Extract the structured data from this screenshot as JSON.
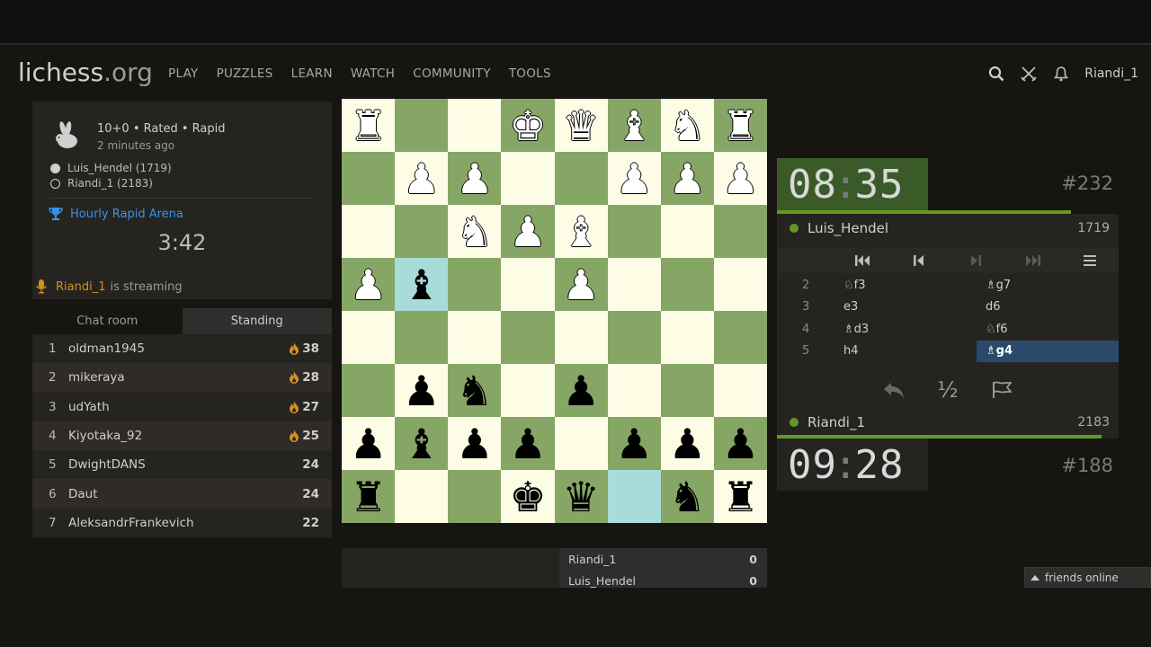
{
  "header": {
    "logo_main": "lichess",
    "logo_tld": ".org",
    "nav": [
      "PLAY",
      "PUZZLES",
      "LEARN",
      "WATCH",
      "COMMUNITY",
      "TOOLS"
    ],
    "user": "Riandi_1"
  },
  "game_info": {
    "title": "10+0 • Rated • Rapid",
    "ago": "2 minutes ago",
    "white_player": "Luis_Hendel (1719)",
    "black_player": "Riandi_1 (2183)",
    "arena": "Hourly Rapid Arena",
    "arena_clock": "3:42",
    "streamer": "Riandi_1",
    "streaming_text": "is streaming"
  },
  "tabs": [
    "Chat room",
    "Standing"
  ],
  "standings": [
    {
      "rank": "1",
      "name": "oldman1945",
      "score": "38",
      "fire": true
    },
    {
      "rank": "2",
      "name": "mikeraya",
      "score": "28",
      "fire": true
    },
    {
      "rank": "3",
      "name": "udYath",
      "score": "27",
      "fire": true
    },
    {
      "rank": "4",
      "name": "Kiyotaka_92",
      "score": "25",
      "fire": true
    },
    {
      "rank": "5",
      "name": "DwightDANS",
      "score": "24",
      "fire": false
    },
    {
      "rank": "6",
      "name": "Daut",
      "score": "24",
      "fire": false
    },
    {
      "rank": "7",
      "name": "AleksandrFrankevich",
      "score": "22",
      "fire": false
    }
  ],
  "board": {
    "ranks": [
      [
        "wR",
        "",
        "",
        "wK",
        "wQ",
        "wB",
        "wN",
        "wR"
      ],
      [
        "",
        "wP",
        "wP",
        "",
        "",
        "wP",
        "wP",
        "wP"
      ],
      [
        "",
        "",
        "wN",
        "wP",
        "wB",
        "",
        "",
        ""
      ],
      [
        "wP",
        "bB",
        "",
        "",
        "wP",
        "",
        "",
        ""
      ],
      [
        "",
        "",
        "",
        "",
        "",
        "",
        "",
        ""
      ],
      [
        "",
        "bP",
        "bN",
        "",
        "bP",
        "",
        "",
        ""
      ],
      [
        "bP",
        "bB",
        "bP",
        "bP",
        "",
        "bP",
        "bP",
        "bP"
      ],
      [
        "bR",
        "",
        "",
        "bK",
        "bQ",
        "",
        "bN",
        "bR"
      ]
    ],
    "highlight": [
      [
        3,
        1
      ],
      [
        7,
        5
      ]
    ]
  },
  "crosstable": [
    {
      "name": "Riandi_1",
      "score": "0"
    },
    {
      "name": "Luis_Hendel",
      "score": "0"
    }
  ],
  "top_player": {
    "clock_min": "08",
    "clock_sec": "35",
    "game_num": "#232",
    "name": "Luis_Hendel",
    "rating": "1719",
    "time_fraction": 0.86
  },
  "bottom_player": {
    "clock_min": "09",
    "clock_sec": "28",
    "game_num": "#188",
    "name": "Riandi_1",
    "rating": "2183",
    "time_fraction": 0.95
  },
  "moves": [
    {
      "no": "2",
      "white": "♘f3",
      "black": "♗g7"
    },
    {
      "no": "3",
      "white": "e3",
      "black": "d6"
    },
    {
      "no": "4",
      "white": "♗d3",
      "black": "♘f6"
    },
    {
      "no": "5",
      "white": "h4",
      "black": "♗g4"
    }
  ],
  "draw_label": "½",
  "friends": "friends online",
  "colors": {
    "accent_green": "#629924",
    "link_blue": "#3893e8",
    "streamer_orange": "#d59020"
  }
}
